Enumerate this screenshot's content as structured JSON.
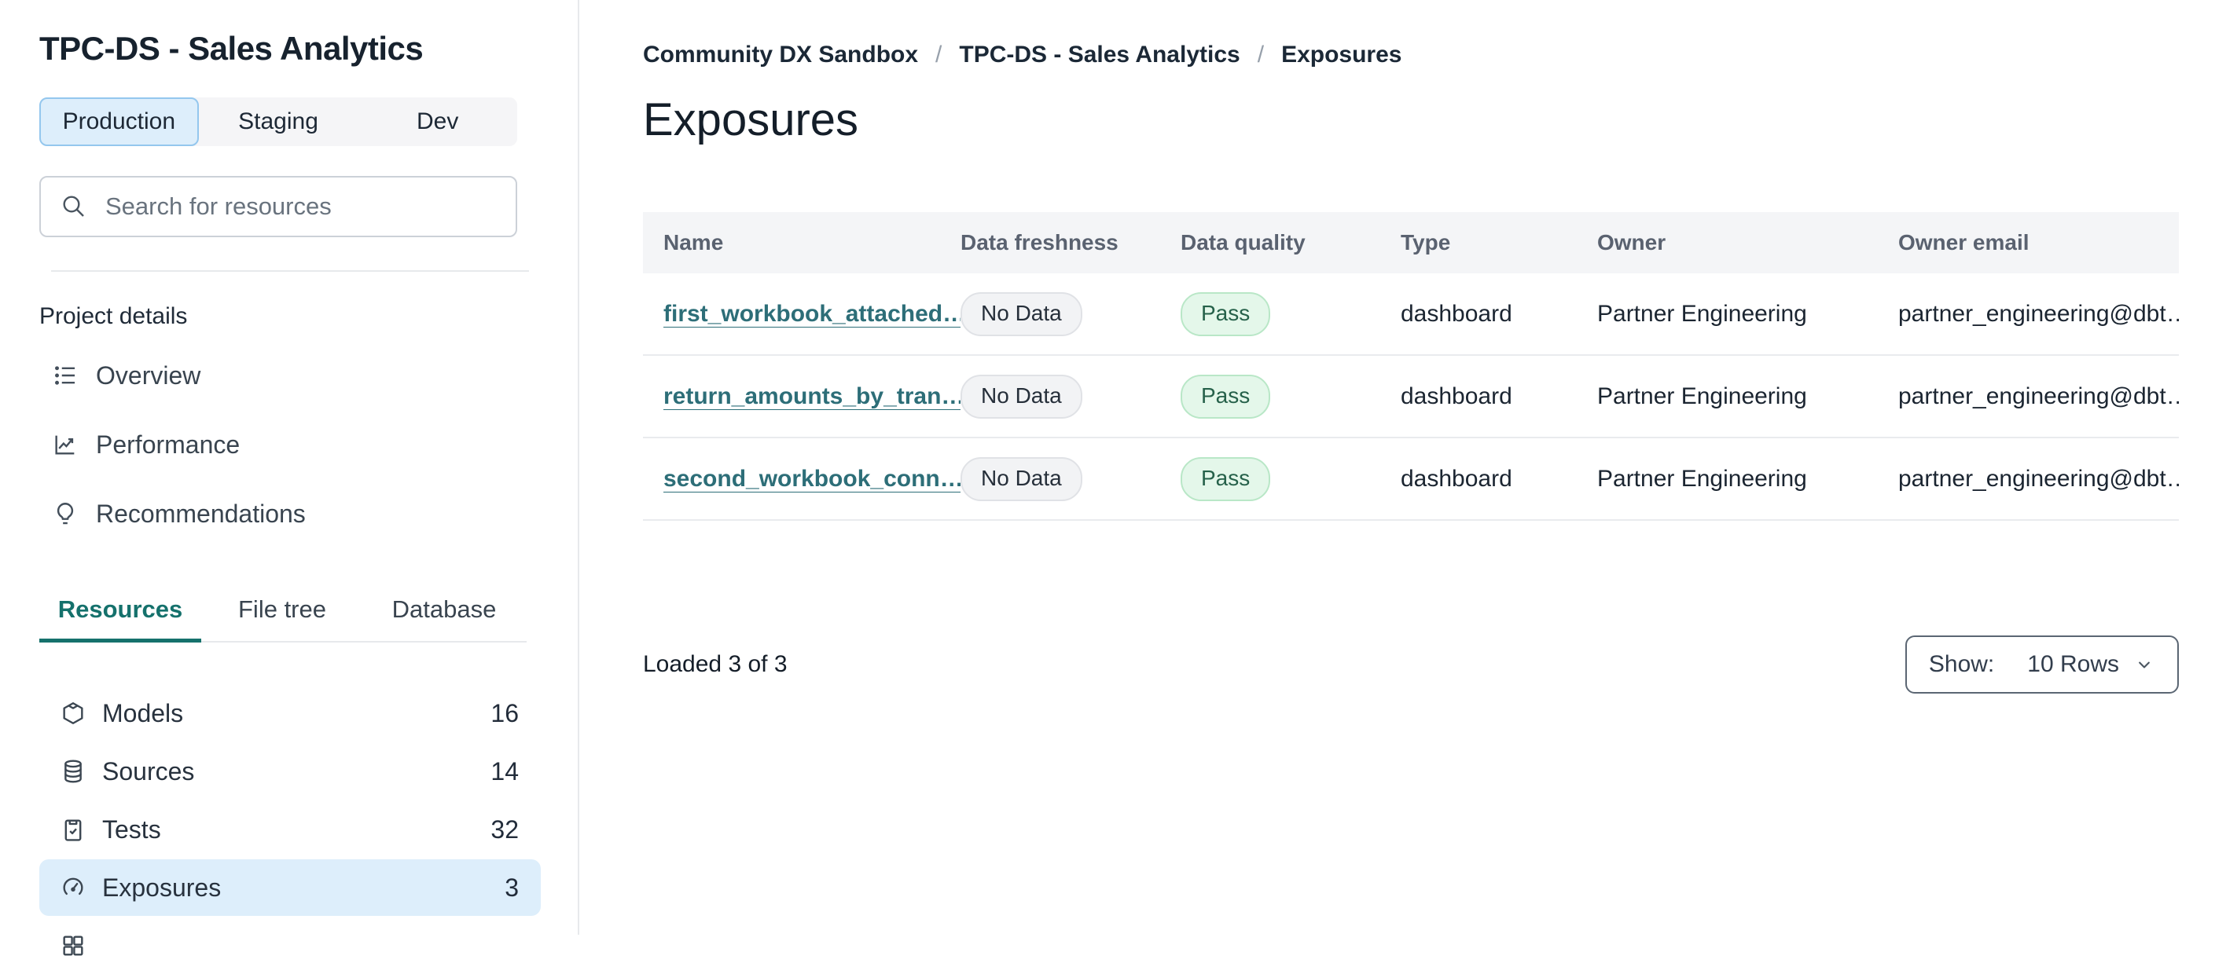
{
  "sidebar": {
    "project_title": "TPC-DS - Sales Analytics",
    "env_tabs": [
      {
        "label": "Production",
        "active": true
      },
      {
        "label": "Staging",
        "active": false
      },
      {
        "label": "Dev",
        "active": false
      }
    ],
    "search": {
      "placeholder": "Search for resources"
    },
    "section_label": "Project details",
    "nav_items": [
      {
        "icon": "list-icon",
        "label": "Overview"
      },
      {
        "icon": "line-chart-icon",
        "label": "Performance"
      },
      {
        "icon": "lightbulb-icon",
        "label": "Recommendations"
      }
    ],
    "resource_tabs": [
      {
        "label": "Resources",
        "active": true
      },
      {
        "label": "File tree",
        "active": false
      },
      {
        "label": "Database",
        "active": false
      }
    ],
    "resources": [
      {
        "icon": "package-icon",
        "label": "Models",
        "count": "16",
        "active": false
      },
      {
        "icon": "database-icon",
        "label": "Sources",
        "count": "14",
        "active": false
      },
      {
        "icon": "clipboard-check-icon",
        "label": "Tests",
        "count": "32",
        "active": false
      },
      {
        "icon": "gauge-icon",
        "label": "Exposures",
        "count": "3",
        "active": true
      }
    ]
  },
  "main": {
    "breadcrumb": [
      {
        "label": "Community DX Sandbox"
      },
      {
        "label": "TPC-DS - Sales Analytics"
      },
      {
        "label": "Exposures"
      }
    ],
    "breadcrumb_separator": "/",
    "page_title": "Exposures",
    "table": {
      "columns": [
        "Name",
        "Data freshness",
        "Data quality",
        "Type",
        "Owner",
        "Owner email"
      ],
      "rows": [
        {
          "name": "first_workbook_attached…",
          "data_freshness": "No Data",
          "data_quality": "Pass",
          "type": "dashboard",
          "owner": "Partner Engineering",
          "owner_email": "partner_engineering@dbt…"
        },
        {
          "name": "return_amounts_by_tran…",
          "data_freshness": "No Data",
          "data_quality": "Pass",
          "type": "dashboard",
          "owner": "Partner Engineering",
          "owner_email": "partner_engineering@dbt…"
        },
        {
          "name": "second_workbook_conn…",
          "data_freshness": "No Data",
          "data_quality": "Pass",
          "type": "dashboard",
          "owner": "Partner Engineering",
          "owner_email": "partner_engineering@dbt…"
        }
      ]
    },
    "footer": {
      "loaded_text": "Loaded 3 of 3",
      "show_label": "Show:",
      "show_value": "10 Rows"
    }
  },
  "colors": {
    "accent_teal": "#15716c",
    "link_teal": "#2d6e78",
    "selected_blue_bg": "#ddeefb",
    "selected_blue_border": "#94c7ee",
    "pass_bg": "#e4f7ea",
    "pass_border": "#b9e7c7",
    "pass_text": "#26614a",
    "nodata_bg": "#f2f3f5",
    "nodata_border": "#e0e2e6",
    "table_header_bg": "#f4f5f7",
    "title_text": "#17222e"
  }
}
